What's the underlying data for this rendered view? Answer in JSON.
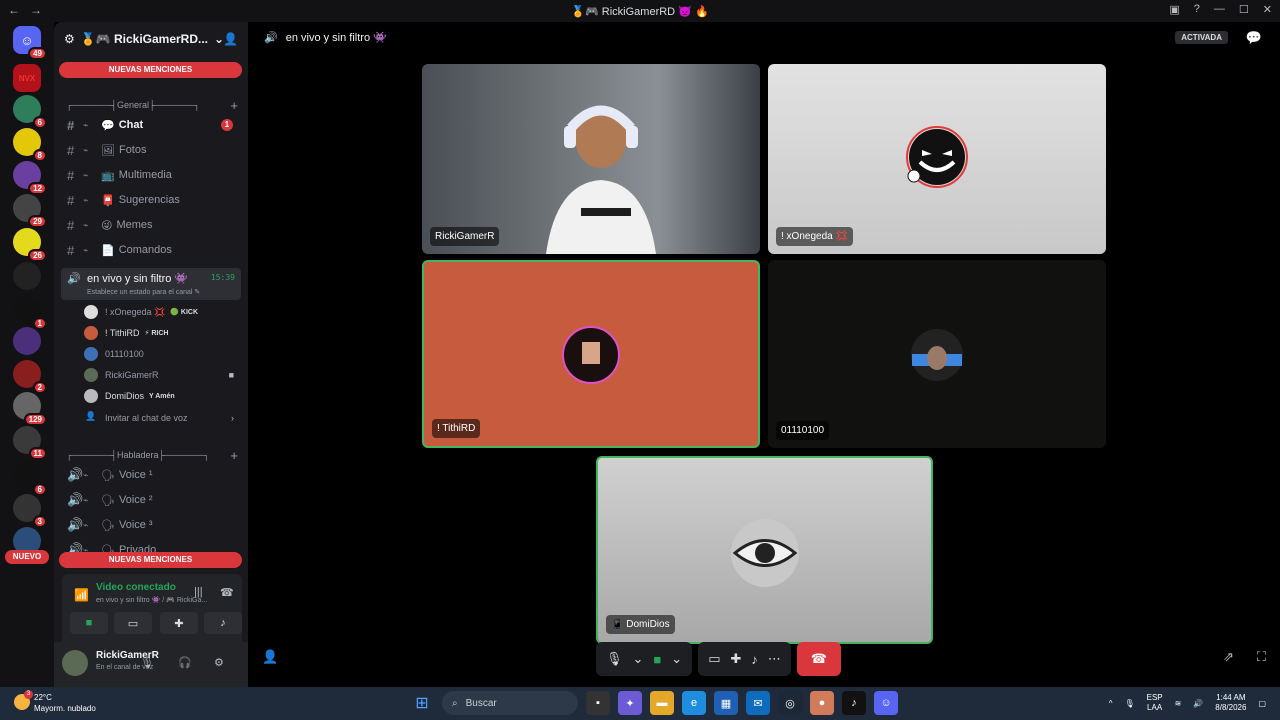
{
  "window": {
    "title": "🏅🎮 RickiGamerRD 👿 🔥",
    "back": "←",
    "forward": "→"
  },
  "guilds": [
    {
      "name": "discord-home",
      "badge": "49",
      "color": "#5865f2"
    },
    {
      "name": "NVX",
      "badge": "",
      "color": "#b3121a"
    },
    {
      "name": "guild-3",
      "badge": "6",
      "color": "#2e7d5b"
    },
    {
      "name": "guild-4",
      "badge": "8",
      "color": "#e3c80a"
    },
    {
      "name": "guild-5",
      "badge": "12",
      "color": "#6a3fa0"
    },
    {
      "name": "guild-6",
      "badge": "29",
      "color": "#444"
    },
    {
      "name": "guild-7",
      "badge": "26",
      "color": "#e5d91e"
    },
    {
      "name": "guild-8",
      "badge": "",
      "color": "#222"
    },
    {
      "name": "guild-9",
      "badge": "1",
      "color": "#111"
    },
    {
      "name": "guild-10",
      "badge": "",
      "color": "#4b2f7a"
    },
    {
      "name": "guild-11",
      "badge": "2",
      "color": "#8a1d1d"
    },
    {
      "name": "guild-12",
      "badge": "129",
      "color": "#666"
    },
    {
      "name": "guild-13",
      "badge": "11",
      "color": "#3a3a3a"
    },
    {
      "name": "guild-14",
      "badge": "6",
      "color": "#111"
    },
    {
      "name": "guild-15",
      "badge": "3",
      "color": "#333"
    },
    {
      "name": "guild-16",
      "badge": "",
      "color": "#2a4d7a"
    }
  ],
  "nuevo_label": "NUEVO",
  "server": {
    "name": "🏅🎮 RickiGamerRD..."
  },
  "mentions_label": "NUEVAS MENCIONES",
  "categories": {
    "general": "┌──────┤General├──────┐",
    "habladera": "┌──────┤Habladera├──────┐"
  },
  "channels": [
    {
      "label": "Chat",
      "emoji": "💬",
      "active": true,
      "badge": "1"
    },
    {
      "label": "Fotos",
      "emoji": "🖼",
      "active": false,
      "badge": ""
    },
    {
      "label": "Multimedia",
      "emoji": "📺",
      "active": false,
      "badge": ""
    },
    {
      "label": "Sugerencias",
      "emoji": "📮",
      "active": false,
      "badge": ""
    },
    {
      "label": "Memes",
      "emoji": "😜",
      "active": false,
      "badge": ""
    },
    {
      "label": "Comandos",
      "emoji": "📄",
      "active": false,
      "badge": ""
    }
  ],
  "voice_channel": {
    "name": "en vivo y sin filtro 👾",
    "time": "15:39",
    "status": "Establece un estado para el canal ✎"
  },
  "voice_users": [
    {
      "name": "! xOnegeda 💢",
      "tag": "🟢 KICK",
      "color": "#ddd"
    },
    {
      "name": "! TithiRD",
      "tag": "⚡ RICH",
      "color": "#c75b3e"
    },
    {
      "name": "01110100",
      "tag": "",
      "color": "#3f6fb5"
    },
    {
      "name": "RickiGamerR",
      "tag": "",
      "color": "#5a6a55",
      "cam": "■"
    },
    {
      "name": "DomiDios",
      "tag": "Y Amén",
      "color": "#bbb"
    }
  ],
  "invite_label": "Invitar al chat de voz",
  "habladera_channels": [
    {
      "label": "Voice ¹"
    },
    {
      "label": "Voice ²"
    },
    {
      "label": "Voice ³"
    },
    {
      "label": "Privado"
    }
  ],
  "connection": {
    "title": "Video conectado",
    "subtitle": "en vivo y sin filtro 👾 / 🎮 RickiGa..."
  },
  "user": {
    "name": "RickiGamerR",
    "status": "En el canal de voz"
  },
  "main": {
    "channel_title": "en vivo y sin filtro 👾",
    "activity_label": "ACTIVADA"
  },
  "tiles": [
    {
      "name": "RickiGamerR"
    },
    {
      "name": "! xOnegeda 💢"
    },
    {
      "name": "! TithiRD"
    },
    {
      "name": "01110100"
    },
    {
      "name": "📱 DomiDios"
    }
  ],
  "taskbar": {
    "temp": "22°C",
    "weather": "Mayorm. nublado",
    "weather_badge": "3",
    "search": "Buscar",
    "lang1": "ESP",
    "lang2": "LAA",
    "time": "1:44 AM",
    "date": "8/8/2026"
  },
  "colors": {
    "accent_green": "#23a55a",
    "danger_red": "#da373c",
    "tithi_bg": "#c75b3e"
  }
}
